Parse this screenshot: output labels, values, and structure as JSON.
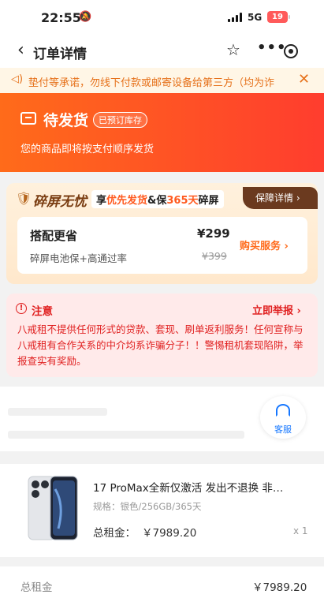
{
  "status_bar": {
    "time": "22:55",
    "network": "5G",
    "battery": "19"
  },
  "nav": {
    "title": "订单详情"
  },
  "notice": {
    "text": "垫付等承诺，勿线下付款或邮寄设备给第三方（均为诈"
  },
  "status": {
    "title": "待发货",
    "badge": "已预订库存",
    "subtitle": "您的商品即将按支付顺序发货"
  },
  "protection": {
    "title": "碎屏无忧",
    "tag_prefix": "享",
    "tag_hl1": "优先发货",
    "tag_mid": "&保",
    "tag_hl2": "365天",
    "tag_suffix": "碎屏",
    "guarantee_label": "保障详情 ›",
    "bundle": {
      "title": "搭配更省",
      "desc": "碎屏电池保+高通过率",
      "price": "¥299",
      "original_price": "¥399",
      "buy_label": "购买服务 ›"
    }
  },
  "warning": {
    "title": "注意",
    "report_label": "立即举报 ›",
    "text": "八戒租不提供任何形式的贷款、套现、刷单返利服务！任何宣称与八戒租有合作关系的中介均系诈骗分子！！警惕租机套现陷阱，举报查实有奖励。"
  },
  "customer_service": {
    "label": "客服"
  },
  "product": {
    "name": "17 ProMax全新仅激活 发出不退换 非…",
    "spec": "规格：银色/256GB/365天",
    "total_label": "总租金：",
    "total": "￥7989.20",
    "qty": "x 1"
  },
  "summary": {
    "label": "总租金",
    "value": "￥7989.20"
  },
  "colors": {
    "accent_orange": "#ff6a1a",
    "header_red": "#ff3d2e",
    "warning_red": "#e02020",
    "service_blue": "#1677ff"
  }
}
